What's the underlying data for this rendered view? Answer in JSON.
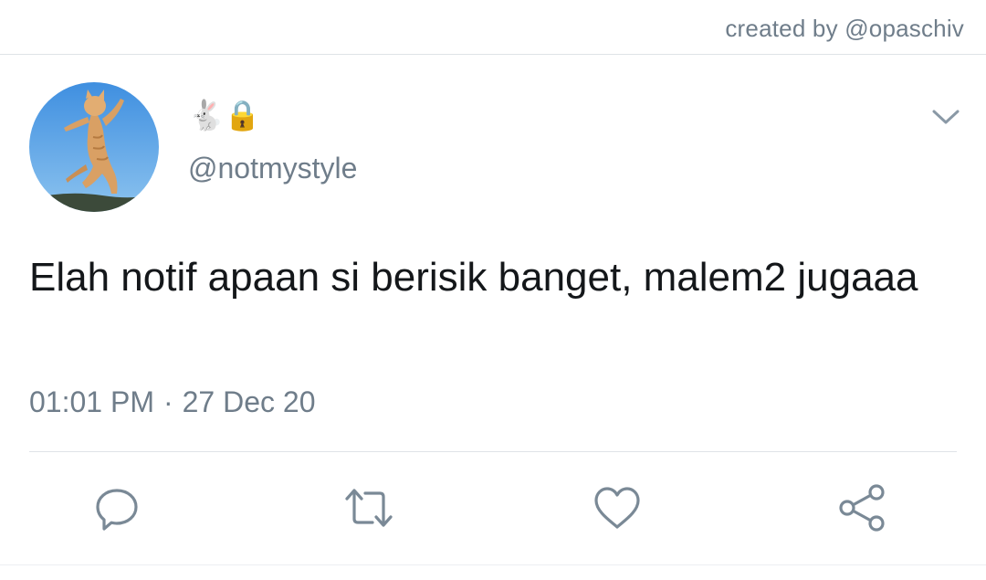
{
  "credit": "created by @opaschiv",
  "tweet": {
    "display_name": "🐇🔒",
    "handle": "@notmystyle",
    "text": "Elah notif apaan si berisik banget, malem2 jugaaa",
    "time": "01:01 PM",
    "separator": "·",
    "date": "27 Dec 20"
  },
  "icons": {
    "menu": "chevron-down-icon",
    "actions": [
      "reply-icon",
      "retweet-icon",
      "like-icon",
      "share-icon"
    ]
  },
  "colors": {
    "text": "#14171a",
    "secondary": "#6f7d8a",
    "divider": "#dfe3e7"
  }
}
